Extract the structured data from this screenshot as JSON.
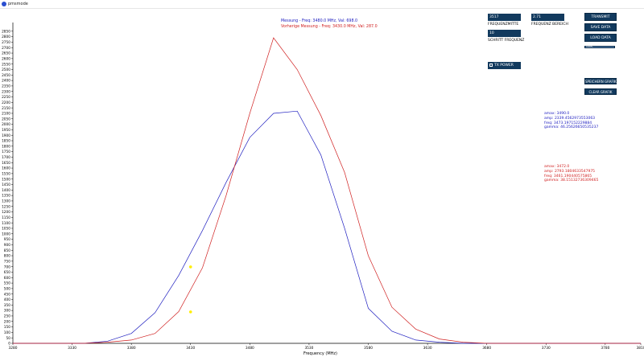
{
  "window": {
    "title": "pmsmode"
  },
  "controls": {
    "center_freq": {
      "value": "3517",
      "label": "FREQUENZMITTE"
    },
    "freq_range": {
      "value": "2.71",
      "label": "FREQUENZ BEREICH"
    },
    "step_freq": {
      "value": "10",
      "label": "SCHRITT FREQUENZ"
    },
    "tx_power": {
      "label": "TX POWER",
      "checked": false
    },
    "progress": {
      "percent": 100,
      "text": "100%"
    }
  },
  "buttons": {
    "transmit": "TRANSMIT",
    "save_data": "SAVE DATA",
    "load_data": "LOAD DATA",
    "save_graph": "SPEICHERN GRAFIK",
    "clear_graph": "CLEAR GRAFIK"
  },
  "legend": {
    "current": "Messung - Freq: 3480.0 MHz, Val: 698.0",
    "previous": "Vorherige Messung - Freq: 3430.0 MHz, Val: 287.0"
  },
  "stats_current": {
    "amax": "amax: 3490.0",
    "amp": "amp: 2339.4562973553063",
    "freq": "freq: 3473.197152229884",
    "gamma": "gamma: 46.25626650535237"
  },
  "stats_previous": {
    "amax": "amax: 3472.0",
    "amp": "amp: 2793.1804633547975",
    "freq": "freq: 3461.190440575865",
    "gamma": "gamma: 38.15132736309465"
  },
  "colors": {
    "current": "#2020c0",
    "previous": "#d02020",
    "marker": "#ffee00",
    "panel": "#123a5e"
  },
  "chart_data": {
    "type": "line",
    "xlabel": "Frequency (MHz)",
    "ylabel": "",
    "xlim": [
      3280,
      3810
    ],
    "ylim": [
      0,
      2900
    ],
    "xticks": [
      3280,
      3330,
      3380,
      3430,
      3480,
      3530,
      3580,
      3630,
      3680,
      3730,
      3780,
      3810
    ],
    "ytick_step": 50,
    "ytick_max": 2850,
    "series": [
      {
        "id": "current",
        "x": [
          3280,
          3320,
          3340,
          3360,
          3380,
          3400,
          3420,
          3440,
          3460,
          3480,
          3500,
          3520,
          3540,
          3560,
          3580,
          3600,
          3620,
          3640,
          3660,
          3680,
          3810
        ],
        "y": [
          0,
          0,
          0,
          20,
          90,
          280,
          620,
          1030,
          1470,
          1880,
          2100,
          2120,
          1720,
          1050,
          320,
          110,
          30,
          10,
          0,
          0,
          0
        ]
      },
      {
        "id": "previous",
        "x": [
          3280,
          3320,
          3340,
          3360,
          3380,
          3400,
          3420,
          3440,
          3460,
          3480,
          3500,
          3520,
          3540,
          3560,
          3580,
          3600,
          3620,
          3640,
          3660,
          3680,
          3810
        ],
        "y": [
          0,
          0,
          0,
          10,
          30,
          90,
          290,
          690,
          1350,
          2100,
          2790,
          2500,
          2080,
          1560,
          800,
          330,
          130,
          40,
          10,
          0,
          0
        ]
      }
    ],
    "markers": [
      {
        "x": 3430,
        "y": 287
      },
      {
        "x": 3430,
        "y": 698
      }
    ],
    "grid": false,
    "legend_position": "top-center"
  }
}
